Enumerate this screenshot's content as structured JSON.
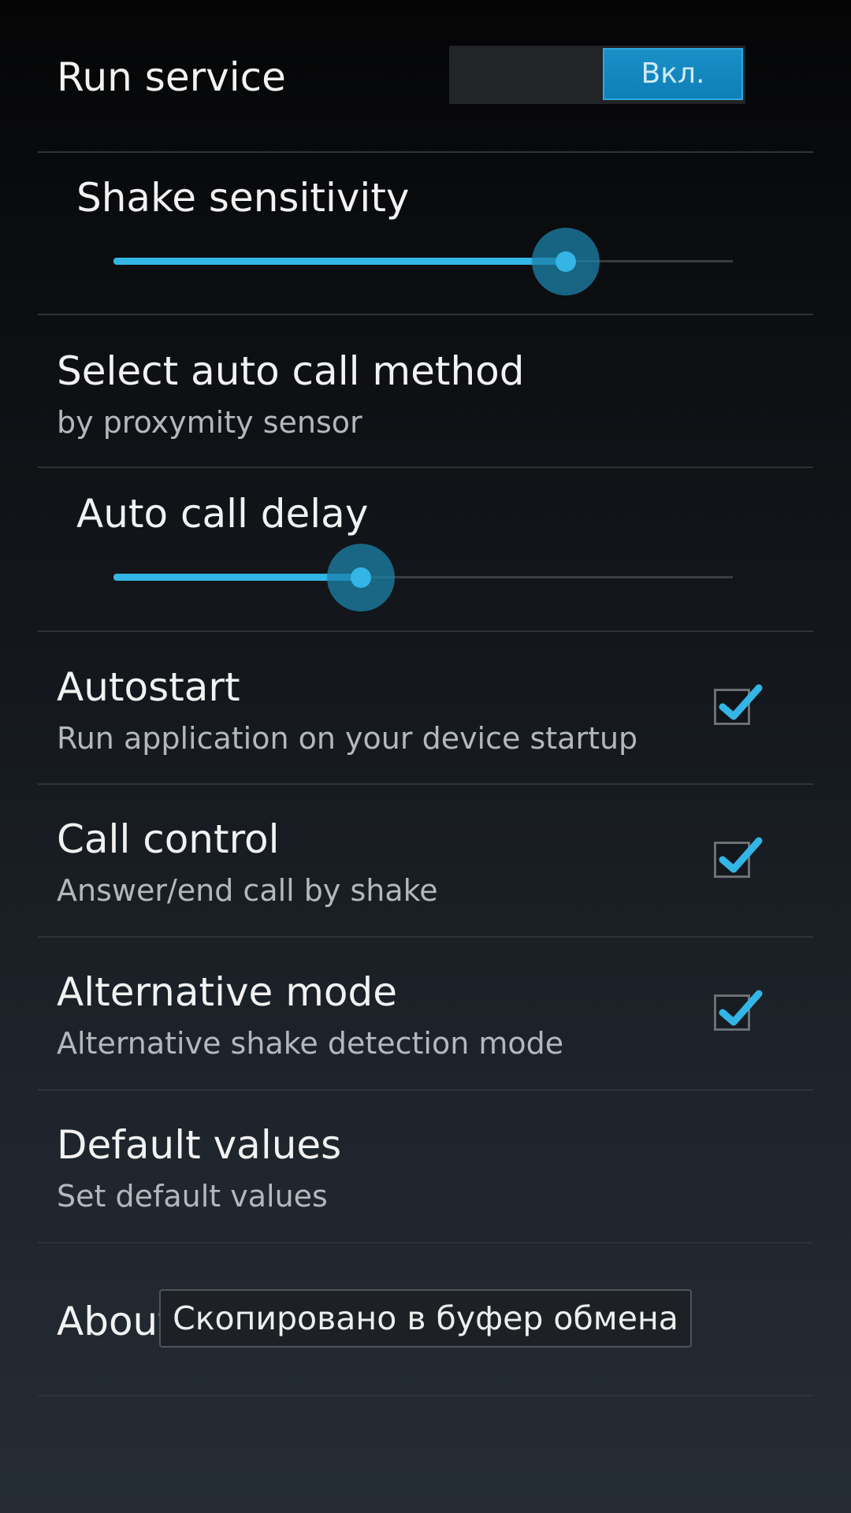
{
  "settings": {
    "run_service": {
      "title": "Run service",
      "switch_label": "Вкл.",
      "checked": true
    },
    "shake_sensitivity": {
      "title": "Shake sensitivity",
      "value_fraction": 0.73
    },
    "auto_call_method": {
      "title": "Select auto call method",
      "summary": "by proxymity sensor"
    },
    "auto_call_delay": {
      "title": "Auto call delay",
      "value_fraction": 0.4
    },
    "autostart": {
      "title": "Autostart",
      "summary": "Run application on your device startup",
      "checked": true
    },
    "call_control": {
      "title": "Call control",
      "summary": "Answer/end call by shake",
      "checked": true
    },
    "alternative_mode": {
      "title": "Alternative mode",
      "summary": "Alternative shake detection mode",
      "checked": true
    },
    "default_values": {
      "title": "Default values",
      "summary": "Set default values"
    },
    "about": {
      "title": "About"
    }
  },
  "toast": {
    "text": "Скопировано в буфер обмена"
  },
  "colors": {
    "accent": "#33b5e5",
    "switch_on": "#0f7fb8",
    "background_top": "#050506",
    "background_bottom": "#252c34",
    "divider": "#2f3338"
  },
  "icons": {
    "checkmark": "check-icon"
  }
}
